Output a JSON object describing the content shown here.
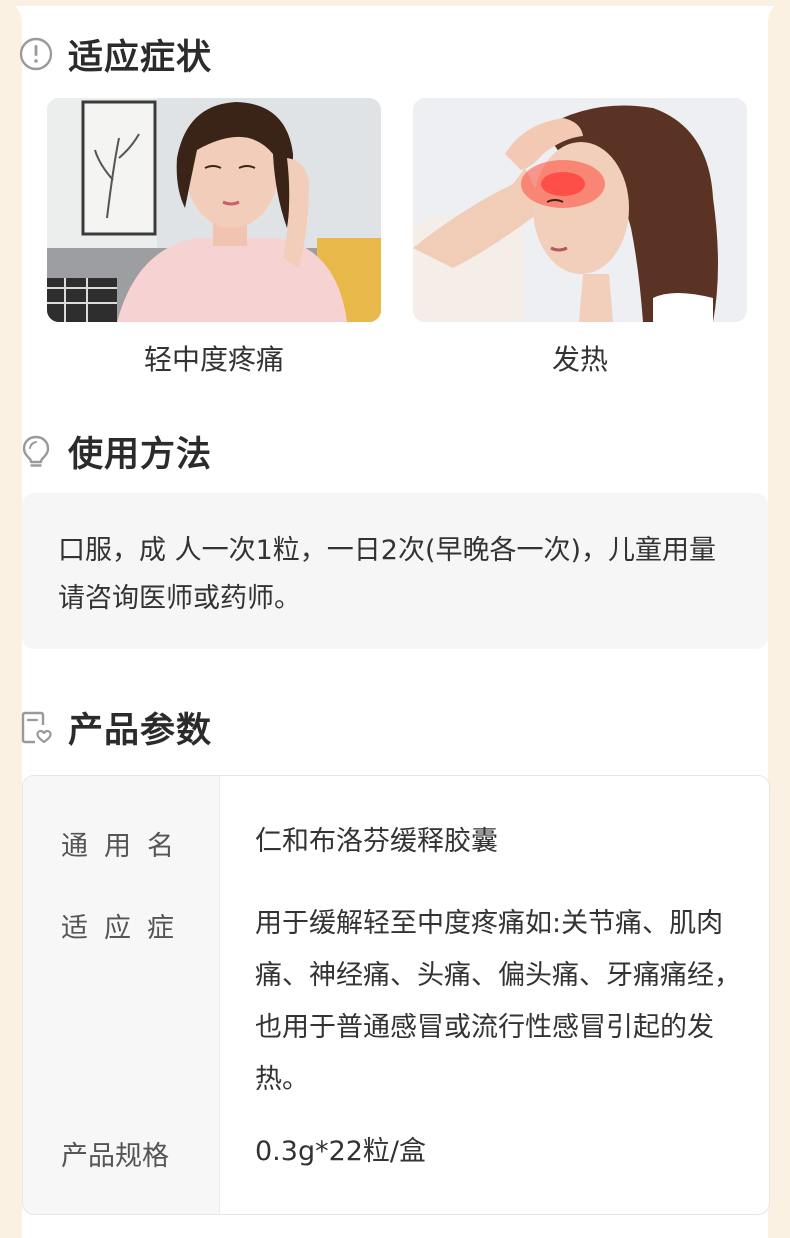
{
  "sections": {
    "indications": {
      "title": "适应症状",
      "icon": "alert-circle-icon",
      "items": [
        {
          "label": "轻中度疼痛"
        },
        {
          "label": "发热"
        }
      ]
    },
    "usage": {
      "title": "使用方法",
      "icon": "lightbulb-icon",
      "text": "口服，成 人一次1粒，一日2次(早晚各一次)，儿童用量请咨询医师或药师。"
    },
    "params": {
      "title": "产品参数",
      "icon": "document-heart-icon",
      "rows": [
        {
          "key": "通用名",
          "value": "仁和布洛芬缓释胶囊"
        },
        {
          "key": "适应症",
          "value": "用于缓解轻至中度疼痛如:关节痛、肌肉痛、神经痛、头痛、偏头痛、牙痛痛经，也用于普通感冒或流行性感冒引起的发热。"
        },
        {
          "key": "产品规格",
          "value": "0.3g*22粒/盒"
        }
      ]
    }
  },
  "colors": {
    "accent_bg": "#fbf1e3",
    "title": "#2b2b2b",
    "box_bg": "#f6f6f6"
  }
}
